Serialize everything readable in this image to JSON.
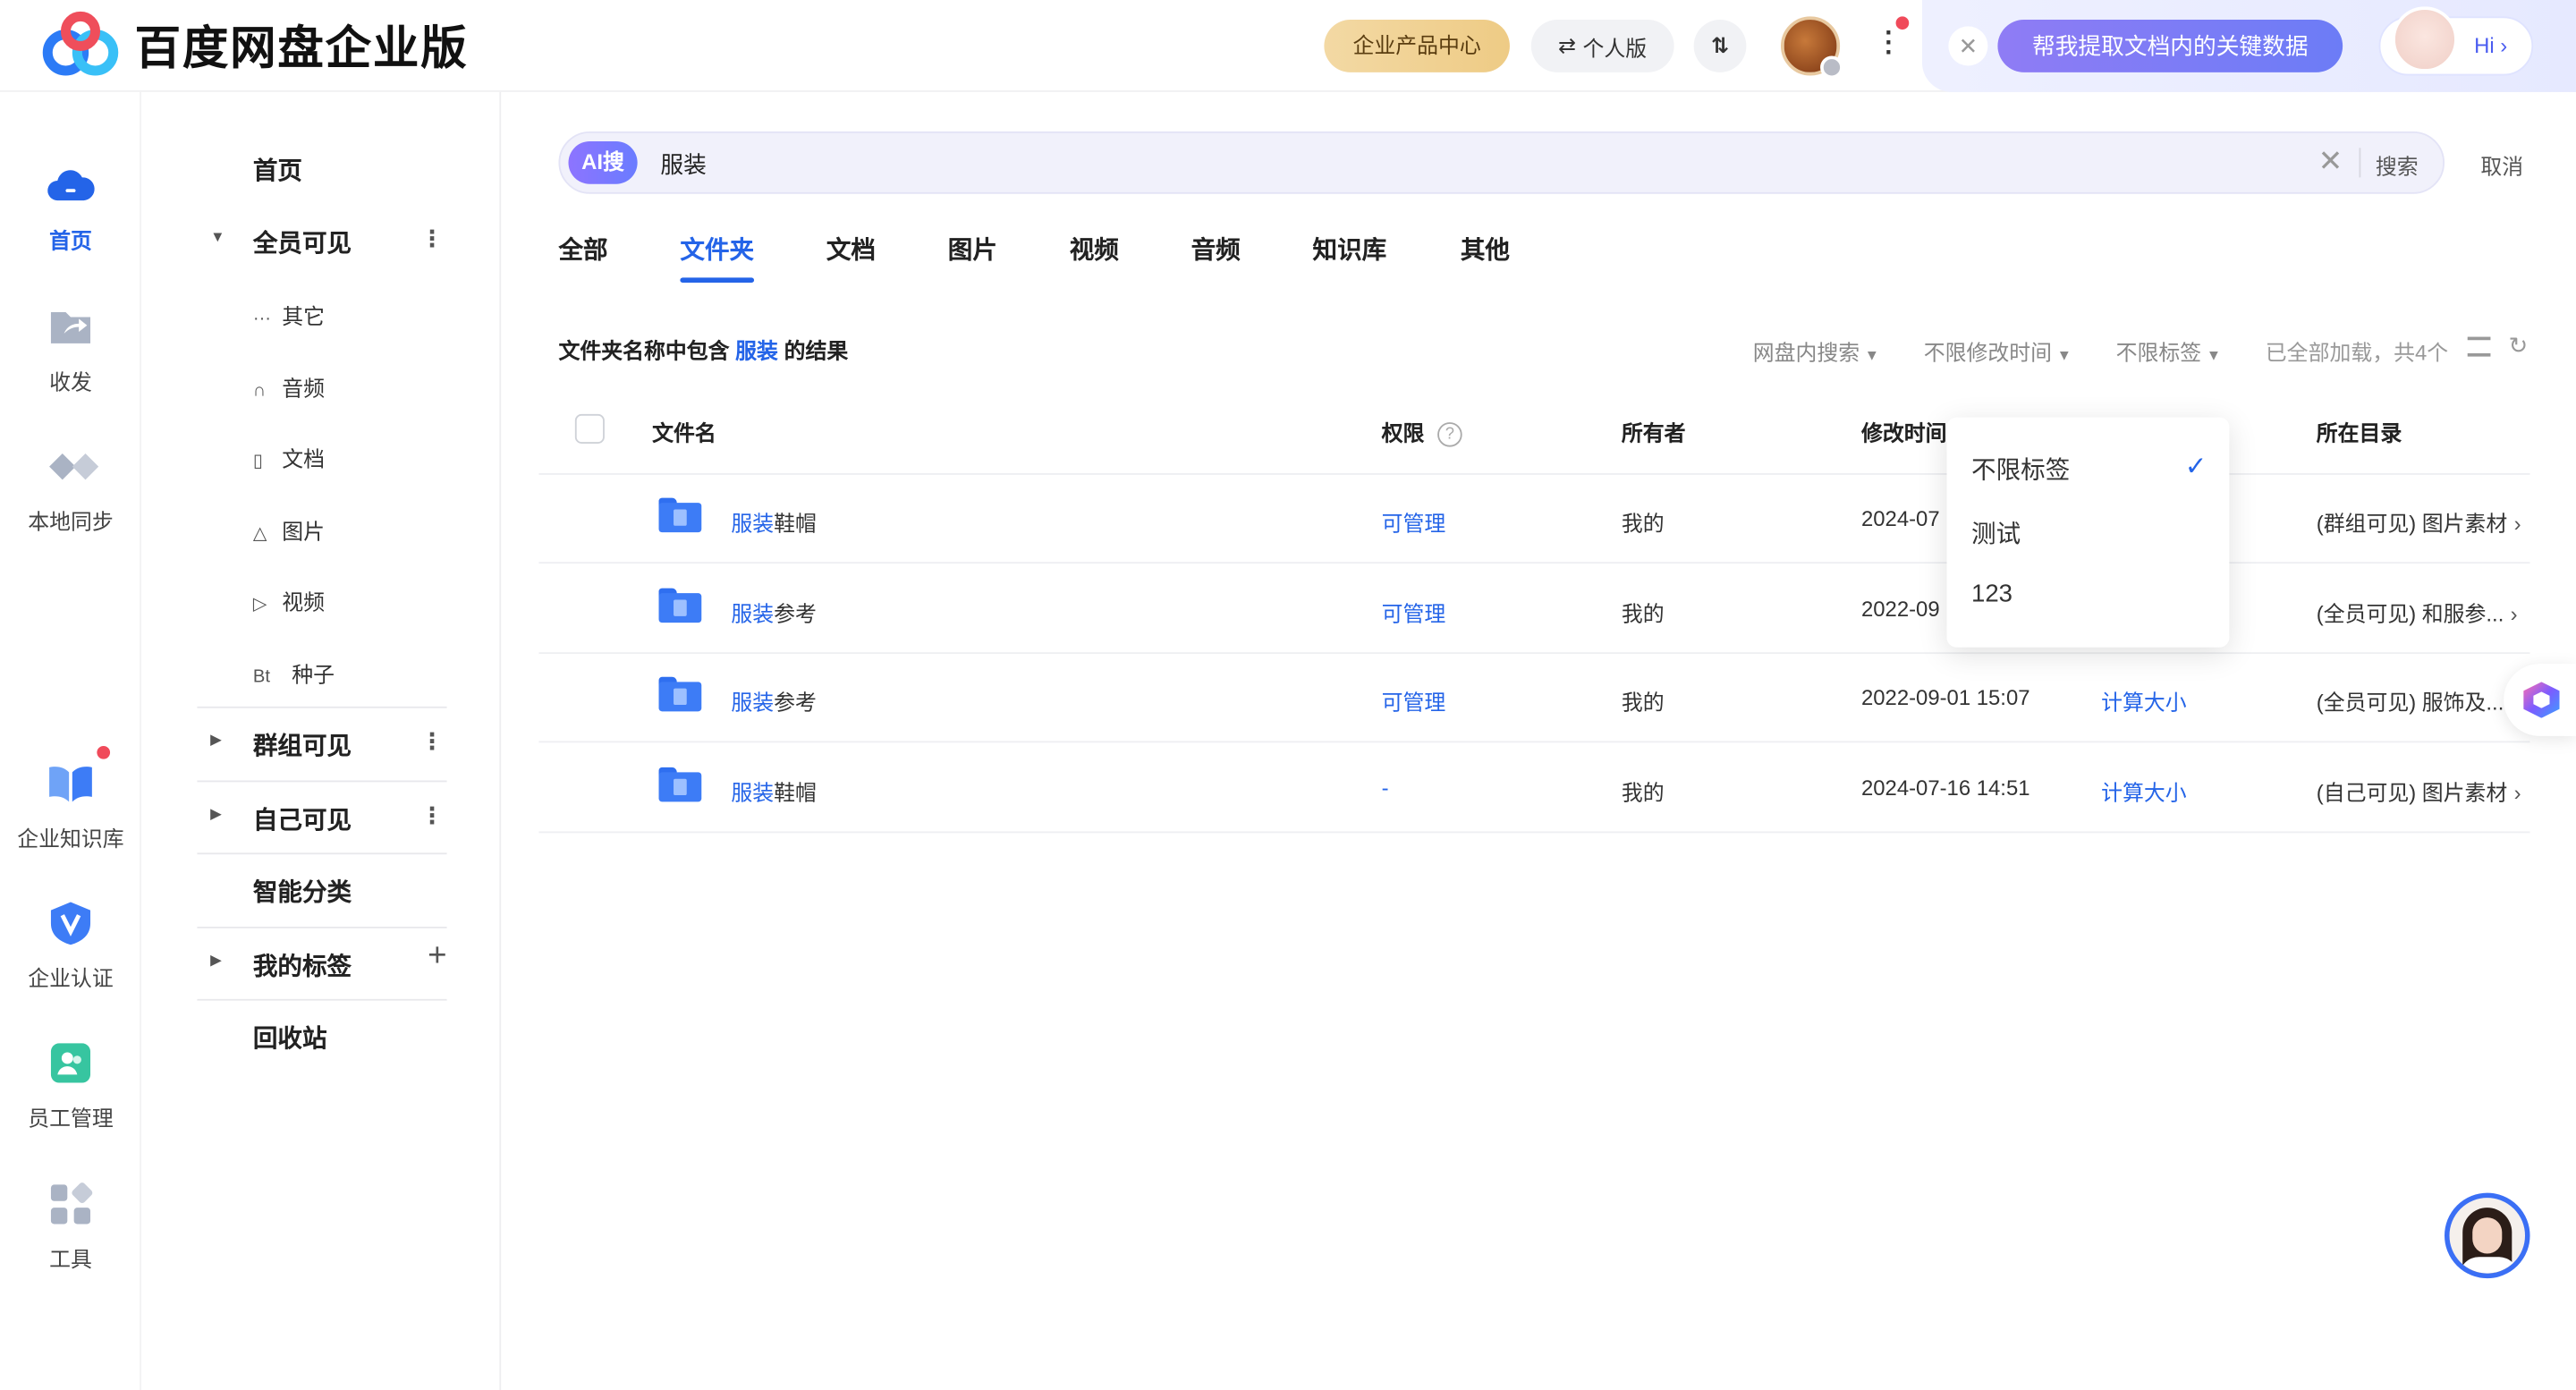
{
  "header": {
    "brand": "百度网盘企业版",
    "product_center": "企业产品中心",
    "personal": "个人版",
    "transfer_icon_text": "⇅",
    "assistant_prompt": "帮我提取文档内的关键数据",
    "hi": "Hi"
  },
  "rail": [
    {
      "label": "首页",
      "icon": "cloud-icon",
      "active": true
    },
    {
      "label": "收发",
      "icon": "share-folder-icon"
    },
    {
      "label": "本地同步",
      "icon": "sync-icon"
    },
    {
      "label": "企业知识库",
      "icon": "book-icon",
      "badge": true
    },
    {
      "label": "企业认证",
      "icon": "verified-icon"
    },
    {
      "label": "员工管理",
      "icon": "staff-icon"
    },
    {
      "label": "工具",
      "icon": "tools-icon"
    }
  ],
  "tree": {
    "home": "首页",
    "all_visible": "全员可见",
    "subs": [
      {
        "icon": "···",
        "label": "其它"
      },
      {
        "icon": "∩",
        "label": "音频"
      },
      {
        "icon": "▯",
        "label": "文档"
      },
      {
        "icon": "△",
        "label": "图片"
      },
      {
        "icon": "▷",
        "label": "视频"
      },
      {
        "icon": "Bt",
        "label": "种子"
      }
    ],
    "group_visible": "群组可见",
    "self_visible": "自己可见",
    "smart": "智能分类",
    "my_tags": "我的标签",
    "recycle": "回收站"
  },
  "search": {
    "badge": "AI搜",
    "query": "服装",
    "go": "搜索",
    "cancel": "取消"
  },
  "tabs": [
    "全部",
    "文件夹",
    "文档",
    "图片",
    "视频",
    "音频",
    "知识库",
    "其他"
  ],
  "active_tab": "文件夹",
  "result": {
    "prefix": "文件夹名称中包含",
    "keyword": "服装",
    "suffix": "的结果"
  },
  "filters": {
    "scope": "网盘内搜索",
    "time": "不限修改时间",
    "tag": "不限标签",
    "meta": "已全部加载，共4个"
  },
  "columns": {
    "name": "文件名",
    "perm": "权限",
    "owner": "所有者",
    "mtime": "修改时间",
    "dir": "所在目录"
  },
  "rows": [
    {
      "kw": "服装",
      "rest": "鞋帽",
      "perm": "可管理",
      "owner": "我的",
      "mtime": "2024-07",
      "size": "",
      "dir": "(群组可见) 图片素材"
    },
    {
      "kw": "服装",
      "rest": "参考",
      "perm": "可管理",
      "owner": "我的",
      "mtime": "2022-09",
      "size": "",
      "dir": "(全员可见) 和服参..."
    },
    {
      "kw": "服装",
      "rest": "参考",
      "perm": "可管理",
      "owner": "我的",
      "mtime": "2022-09-01 15:07",
      "size": "计算大小",
      "dir": "(全员可见) 服饰及..."
    },
    {
      "kw": "服装",
      "rest": "鞋帽",
      "perm": "-",
      "owner": "我的",
      "mtime": "2024-07-16 14:51",
      "size": "计算大小",
      "dir": "(自己可见) 图片素材"
    }
  ],
  "dropdown": {
    "items": [
      "不限标签",
      "测试",
      "123"
    ],
    "selected": "不限标签"
  },
  "colors": {
    "accent": "#2464e8",
    "gold": "#eecb85",
    "assistant": "#7a7cf5"
  }
}
